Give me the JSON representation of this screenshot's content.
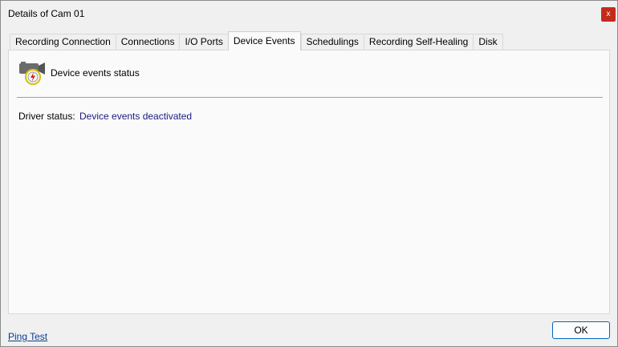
{
  "window": {
    "title": "Details of Cam 01",
    "close_label": "x"
  },
  "tabs": [
    {
      "label": "Recording Connection",
      "active": false
    },
    {
      "label": "Connections",
      "active": false
    },
    {
      "label": "I/O Ports",
      "active": false
    },
    {
      "label": "Device Events",
      "active": true
    },
    {
      "label": "Schedulings",
      "active": false
    },
    {
      "label": "Recording Self-Healing",
      "active": false
    },
    {
      "label": "Disk",
      "active": false
    }
  ],
  "device_events": {
    "heading": "Device events status",
    "icon": "camera-event-icon",
    "driver_status_label": "Driver status:",
    "driver_status_value": "Device events deactivated"
  },
  "footer": {
    "ping_test_label": "Ping Test",
    "ok_label": "OK"
  },
  "colors": {
    "accent": "#0067c0",
    "status_text": "#1a1a80",
    "close_button": "#c42b1c",
    "event_badge": "#d4c21a"
  }
}
